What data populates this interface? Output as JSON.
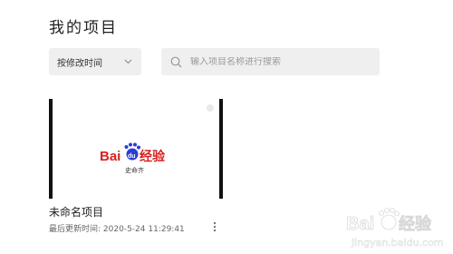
{
  "header": {
    "title": "我的项目"
  },
  "toolbar": {
    "sort_label": "按修改时间",
    "search_placeholder": "输入项目名称进行搜索"
  },
  "projects": [
    {
      "name": "未命名项目",
      "updated_label": "最后更新时间:",
      "updated_time": "2020-5-24 11:29:41",
      "thumbnail": {
        "logo_text_bai": "Bai",
        "logo_text_du": "du",
        "logo_text_jingyan": "经验",
        "author": "史命齐"
      }
    }
  ],
  "watermark": {
    "bai": "Bai",
    "jingyan": "经验",
    "url": "jingyan.baidu.com"
  },
  "colors": {
    "logo_red": "#d9201e",
    "logo_blue": "#2a3bd6",
    "input_bg": "#efefef"
  }
}
